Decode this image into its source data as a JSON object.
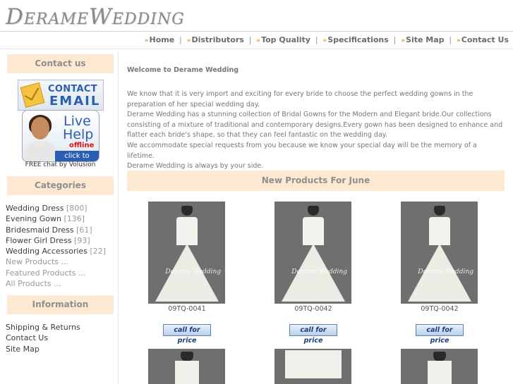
{
  "logo": "DerameWedding",
  "nav": [
    "Home",
    "Distributors",
    "Top Quality",
    "Specifications",
    "Site Map",
    "Contact Us"
  ],
  "sidebar": {
    "contact_head": "Contact us",
    "email_line1": "CONTACT",
    "email_line2": "EMAIL",
    "help_live": "Live",
    "help_help": "Help",
    "help_status": "offline",
    "help_click": "click to email",
    "free_chat": "FREE chat by Volusion",
    "categories_head": "Categories",
    "categories": [
      {
        "label": "Wedding Dress",
        "count": "[800]"
      },
      {
        "label": "Evening Gown",
        "count": "[136]"
      },
      {
        "label": "Bridesmaid Dress",
        "count": "[61]"
      },
      {
        "label": "Flower Girl Dress",
        "count": "[93]"
      },
      {
        "label": "Wedding Accessories",
        "count": "[22]"
      },
      {
        "label": "New Products ...",
        "count": ""
      },
      {
        "label": "Featured Products ...",
        "count": ""
      },
      {
        "label": "All Products ...",
        "count": ""
      }
    ],
    "information_head": "Information",
    "info_links": [
      "Shipping & Returns",
      "Contact Us",
      "Site Map"
    ]
  },
  "main": {
    "welcome_title": "Welcome to Derame Wedding",
    "welcome_paragraphs": [
      "We know that it is very import and exciting for every bride to choose the perfect wedding gowns in the preparation of her special wedding day.",
      "Derame Wedding has a stunning collection of Bridal Gowns for the Modern and Elegant bride.Our collections consisting of a mixture of traditional and contemporary designs.Every gown has been designed to enhance and flatter each bride's shape, so that they can feel fantastic on the wedding day.",
      "We accommodate special requests from you because we know your special day will be the memory of a lifetime.",
      "Derame Wedding is always by your side."
    ],
    "new_products_title": "New Products For June",
    "watermark": "Derame Wedding",
    "call_label": "call for price",
    "products": [
      {
        "code": "09TQ-0041"
      },
      {
        "code": "09TQ-0042"
      },
      {
        "code": "09TQ-0042"
      }
    ]
  }
}
